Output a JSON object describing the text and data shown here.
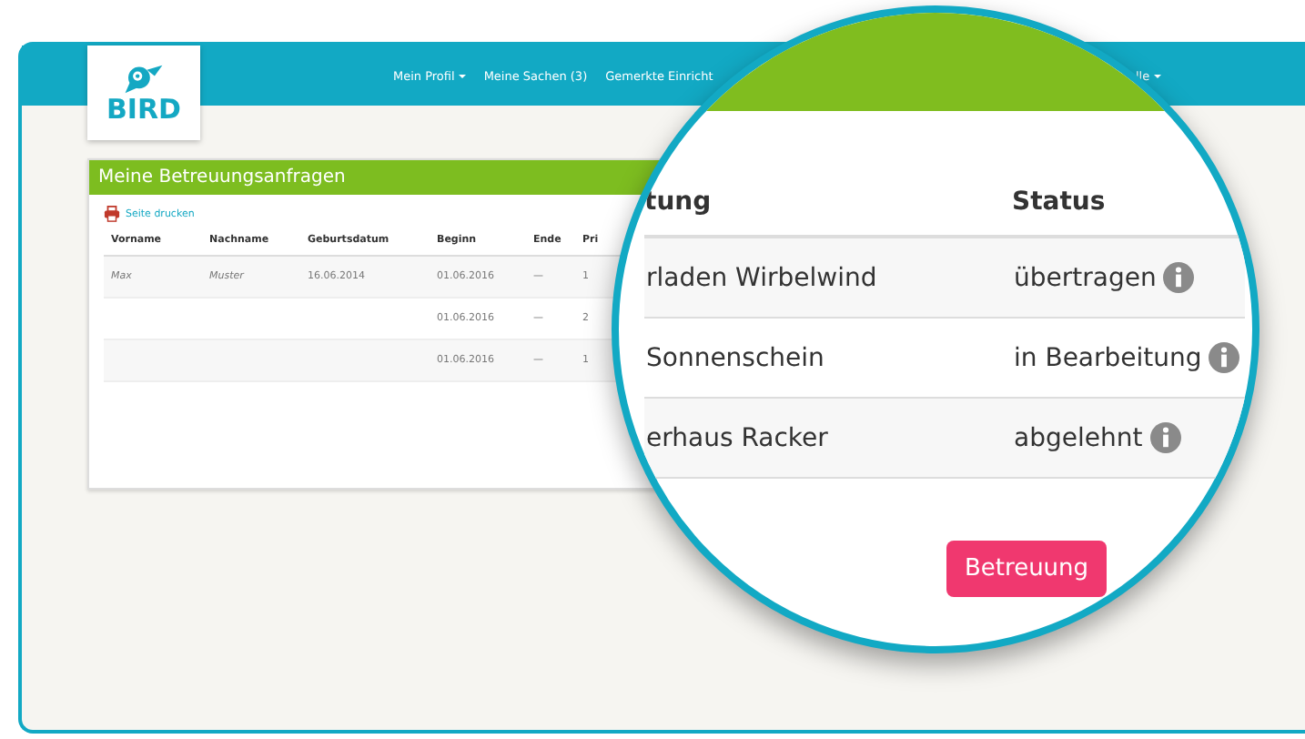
{
  "header": {
    "logo_text": "BIRD",
    "nav": [
      {
        "label": "Mein Profil",
        "dropdown": true
      },
      {
        "label": "Meine Sachen (3)",
        "dropdown": false
      },
      {
        "label": "Gemerkte Einricht",
        "dropdown": false
      }
    ],
    "nav_right": {
      "label": "lle",
      "dropdown": true
    }
  },
  "card": {
    "title": "Meine Betreuungsanfragen",
    "print_link": "Seite drucken",
    "columns": [
      "Vorname",
      "Nachname",
      "Geburtsdatum",
      "Beginn",
      "Ende",
      "Pri"
    ],
    "rows": [
      {
        "vorname": "Max",
        "nachname": "Muster",
        "geburtsdatum": "16.06.2014",
        "beginn": "01.06.2016",
        "ende": "—",
        "column_6": "1"
      },
      {
        "beginn": "01.06.2016",
        "ende": "—",
        "column_6": "2"
      },
      {
        "beginn": "01.06.2016",
        "ende": "—",
        "column_6": "1"
      }
    ]
  },
  "magnifier": {
    "columns": [
      "tung",
      "Status"
    ],
    "rows": [
      {
        "column_1": "rladen Wirbelwind",
        "status": "übertragen"
      },
      {
        "column_1": "Sonnenschein",
        "status": "in Bearbeitung"
      },
      {
        "column_1": "erhaus Racker",
        "status": "abgelehnt"
      }
    ],
    "button": "Betreuung"
  }
}
